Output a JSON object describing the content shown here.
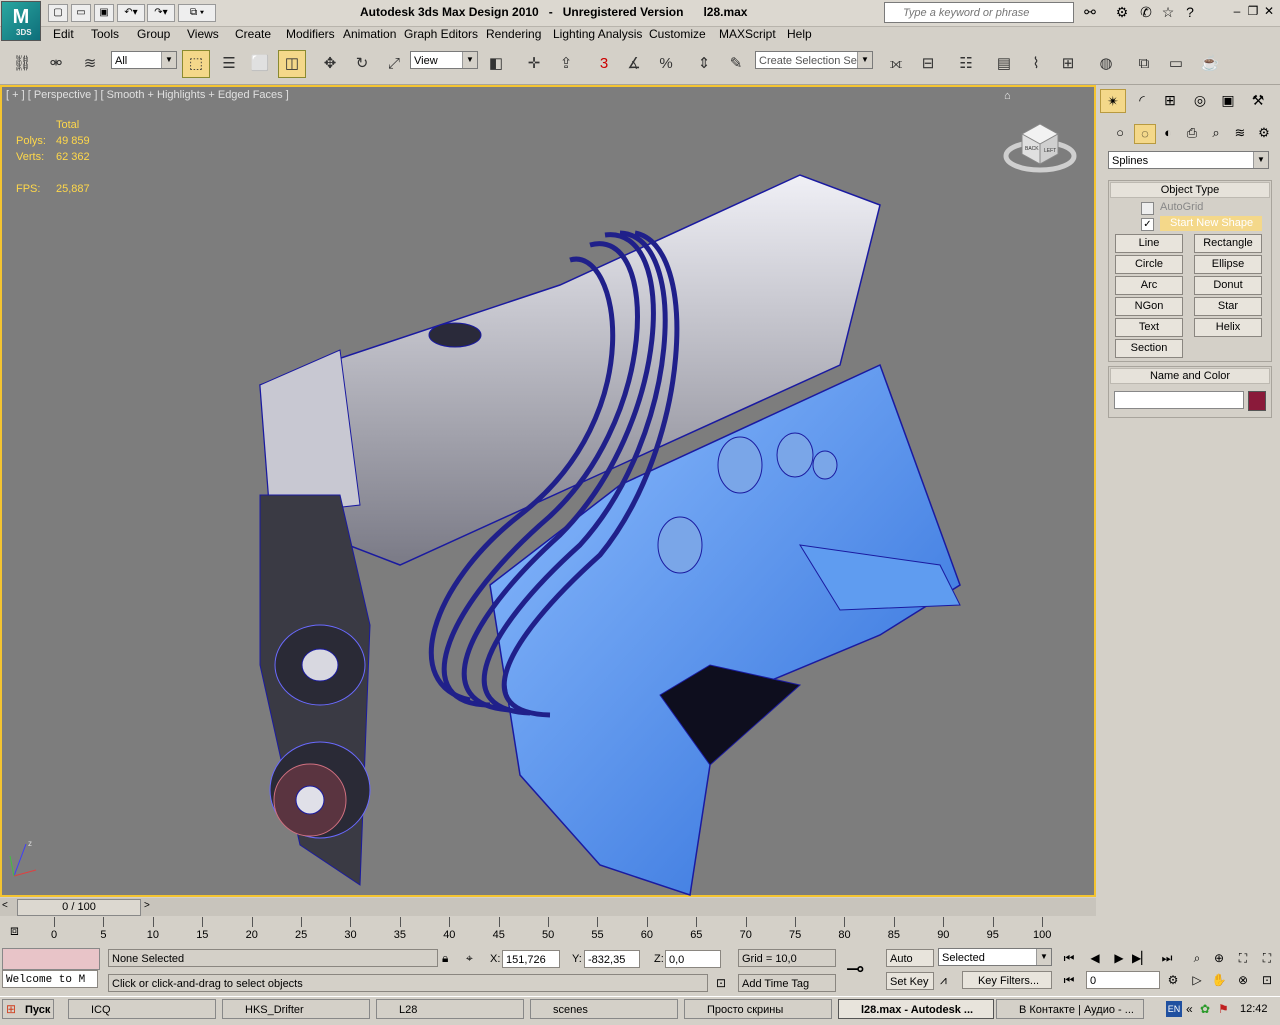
{
  "app": {
    "title": "Autodesk 3ds Max Design 2010   -   Unregistered Version      l28.max",
    "logo_text": "M",
    "logo_sub": "3DS",
    "search_placeholder": "Type a keyword or phrase"
  },
  "menu": [
    "Edit",
    "Tools",
    "Group",
    "Views",
    "Create",
    "Modifiers",
    "Animation",
    "Graph Editors",
    "Rendering",
    "Lighting Analysis",
    "Customize",
    "MAXScript",
    "Help"
  ],
  "toolbar": {
    "filter": "All",
    "ref_coord": "View",
    "snap_label": "3",
    "angle_label": "%",
    "selection_set_placeholder": "Create Selection Se"
  },
  "viewport": {
    "label": "[ + ] [ Perspective ] [ Smooth + Highlights + Edged Faces ]",
    "stats": {
      "total_label": "Total",
      "polys_label": "Polys:",
      "polys_value": "49 859",
      "verts_label": "Verts:",
      "verts_value": "62 362",
      "fps_label": "FPS:",
      "fps_value": "25,887"
    },
    "viewcube": {
      "face_left": "BACK",
      "face_right": "LEFT"
    }
  },
  "command_panel": {
    "category": "Splines",
    "object_type_title": "Object Type",
    "autogrid_label": "AutoGrid",
    "start_new_shape_label": "Start New Shape",
    "buttons": [
      "Line",
      "Rectangle",
      "Circle",
      "Ellipse",
      "Arc",
      "Donut",
      "NGon",
      "Star",
      "Text",
      "Helix",
      "Section"
    ],
    "name_color_title": "Name and Color",
    "object_name": "",
    "color": "#8a1a3a"
  },
  "timeline": {
    "slider_label": "0 / 100",
    "ticks": [
      "0",
      "5",
      "10",
      "15",
      "20",
      "25",
      "30",
      "35",
      "40",
      "45",
      "50",
      "55",
      "60",
      "65",
      "70",
      "75",
      "80",
      "85",
      "90",
      "95",
      "100"
    ]
  },
  "status": {
    "maxscript_text": "Welcome to M",
    "selection": "None Selected",
    "prompt": "Click or click-and-drag to select objects",
    "x_label": "X:",
    "x_value": "151,726",
    "y_label": "Y:",
    "y_value": "-832,35",
    "z_label": "Z:",
    "z_value": "0,0",
    "grid": "Grid = 10,0",
    "add_time_tag": "Add Time Tag",
    "auto_key": "Auto Key",
    "set_key": "Set Key",
    "key_mode": "Selected",
    "key_filters": "Key Filters...",
    "frame": "0"
  },
  "taskbar": {
    "start": "Пуск",
    "tasks": [
      "ICQ",
      "HKS_Drifter",
      "L28",
      "scenes",
      "Просто скрины",
      "l28.max - Autodesk ...",
      "В Контакте | Аудио - ..."
    ],
    "lang": "EN",
    "clock": "12:42"
  }
}
